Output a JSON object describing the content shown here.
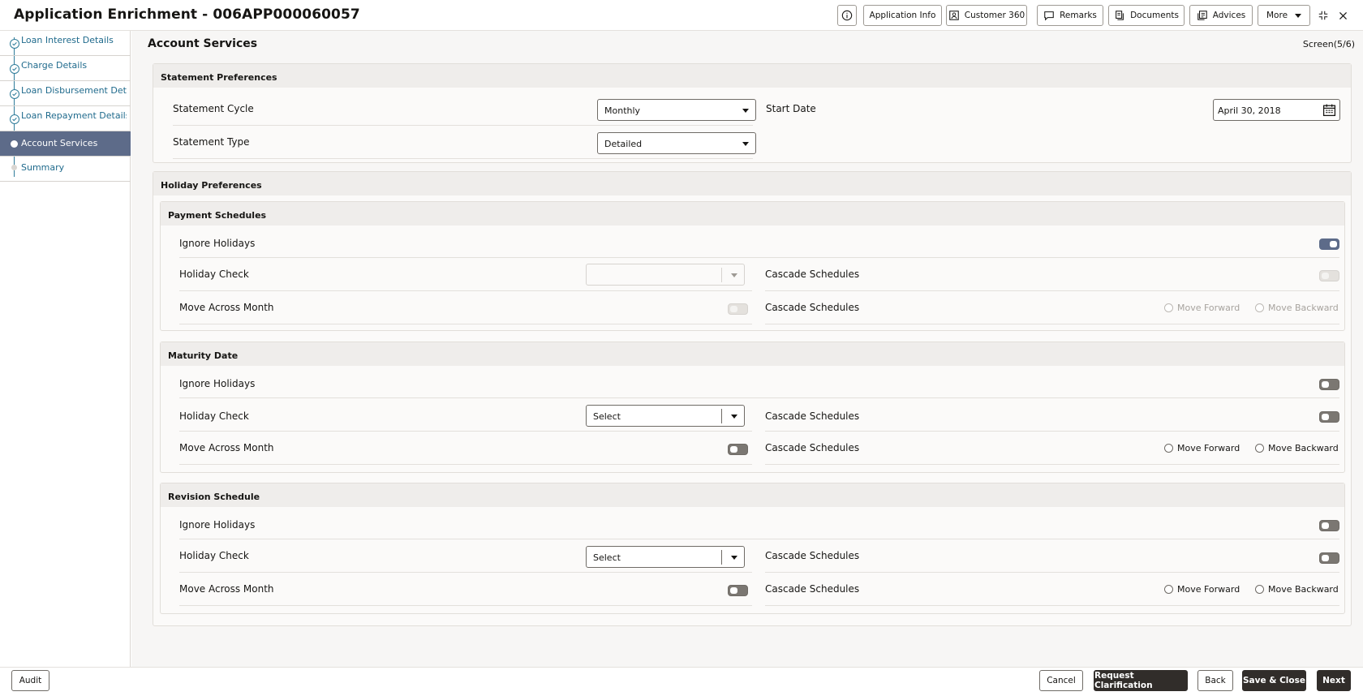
{
  "header": {
    "title": "Application Enrichment - 006APP000060057",
    "buttons": {
      "application_info": "Application Info",
      "customer_360": "Customer 360",
      "remarks": "Remarks",
      "documents": "Documents",
      "advices": "Advices",
      "more": "More"
    }
  },
  "sidebar": {
    "items": [
      {
        "label": "Loan Interest Details"
      },
      {
        "label": "Charge Details"
      },
      {
        "label": "Loan Disbursement Det..."
      },
      {
        "label": "Loan Repayment Details"
      },
      {
        "label": "Account Services"
      },
      {
        "label": "Summary"
      }
    ]
  },
  "main": {
    "title": "Account Services",
    "screen": "Screen(5/6)",
    "statement": {
      "heading": "Statement Preferences",
      "cycle_label": "Statement Cycle",
      "cycle_value": "Monthly",
      "start_date_label": "Start Date",
      "start_date_value": "April 30, 2018",
      "type_label": "Statement Type",
      "type_value": "Detailed"
    },
    "holiday": {
      "heading": "Holiday Preferences",
      "payment": {
        "heading": "Payment Schedules",
        "ignore_label": "Ignore Holidays",
        "check_label": "Holiday Check",
        "check_value": "",
        "cascade_label": "Cascade Schedules",
        "move_label": "Move Across Month",
        "cascade2_label": "Cascade Schedules",
        "forward": "Move Forward",
        "backward": "Move Backward"
      },
      "maturity": {
        "heading": "Maturity Date",
        "ignore_label": "Ignore Holidays",
        "check_label": "Holiday Check",
        "check_value": "Select",
        "cascade_label": "Cascade Schedules",
        "move_label": "Move Across Month",
        "cascade2_label": "Cascade Schedules",
        "forward": "Move Forward",
        "backward": "Move Backward"
      },
      "revision": {
        "heading": "Revision Schedule",
        "ignore_label": "Ignore Holidays",
        "check_label": "Holiday Check",
        "check_value": "Select",
        "cascade_label": "Cascade Schedules",
        "move_label": "Move Across Month",
        "cascade2_label": "Cascade Schedules",
        "forward": "Move Forward",
        "backward": "Move Backward"
      }
    }
  },
  "footer": {
    "audit": "Audit",
    "cancel": "Cancel",
    "request_clarification": "Request Clarification",
    "back": "Back",
    "save_close": "Save & Close",
    "next": "Next"
  },
  "colors": {
    "accent": "#5d6b89",
    "link": "#1f6a8c",
    "dark_button": "#312d2a"
  }
}
